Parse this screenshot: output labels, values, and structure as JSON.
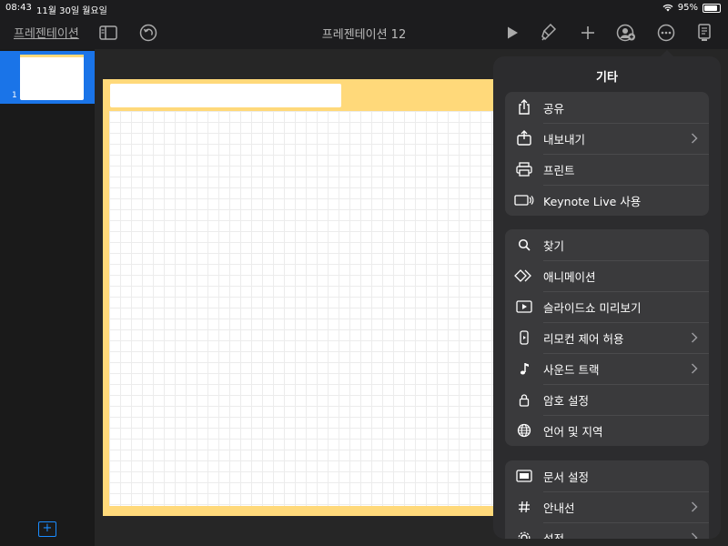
{
  "status": {
    "time": "08:43",
    "date": "11월 30일 월요일",
    "battery": "95%"
  },
  "toolbar": {
    "back_label": "프레젠테이션",
    "doc_title": "프레젠테이션 12"
  },
  "sidebar": {
    "slide_number": "1"
  },
  "menu": {
    "title": "기타",
    "groups": [
      [
        {
          "label": "공유",
          "icon": "share-icon",
          "chevron": false
        },
        {
          "label": "내보내기",
          "icon": "export-icon",
          "chevron": true
        },
        {
          "label": "프린트",
          "icon": "printer-icon",
          "chevron": false
        },
        {
          "label": "Keynote Live 사용",
          "icon": "keynote-live-icon",
          "chevron": false
        }
      ],
      [
        {
          "label": "찾기",
          "icon": "search-icon",
          "chevron": false
        },
        {
          "label": "애니메이션",
          "icon": "animation-icon",
          "chevron": false
        },
        {
          "label": "슬라이드쇼 미리보기",
          "icon": "slideshow-preview-icon",
          "chevron": false
        },
        {
          "label": "리모컨 제어 허용",
          "icon": "remote-icon",
          "chevron": true
        },
        {
          "label": "사운드 트랙",
          "icon": "music-note-icon",
          "chevron": true
        },
        {
          "label": "암호 설정",
          "icon": "lock-icon",
          "chevron": false
        },
        {
          "label": "언어 및 지역",
          "icon": "globe-icon",
          "chevron": false
        }
      ],
      [
        {
          "label": "문서 설정",
          "icon": "document-setup-icon",
          "chevron": false
        },
        {
          "label": "안내선",
          "icon": "guides-icon",
          "chevron": true
        },
        {
          "label": "설정",
          "icon": "settings-icon",
          "chevron": true
        }
      ]
    ]
  }
}
